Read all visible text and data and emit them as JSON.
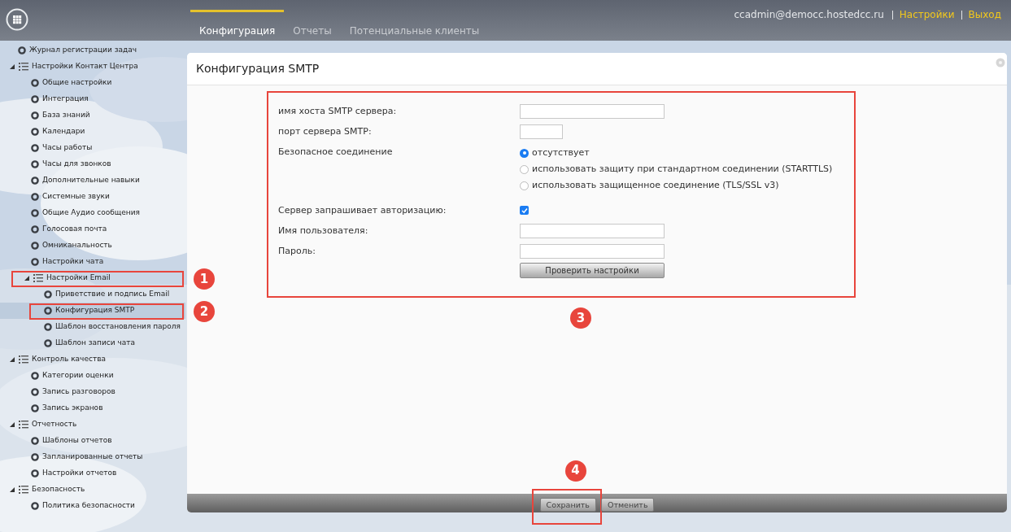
{
  "header": {
    "tabs": [
      {
        "label": "Конфигурация",
        "selected": true
      },
      {
        "label": "Отчеты",
        "selected": false
      },
      {
        "label": "Потенциальные клиенты",
        "selected": false
      }
    ],
    "user": "ccadmin@democc.hostedcc.ru",
    "links": [
      "Настройки",
      "Выход"
    ]
  },
  "sidebar": {
    "items": [
      {
        "label": "Журнал регистрации задач",
        "kind": "leaf",
        "selected": false
      },
      {
        "label": "Настройки Контакт Центра",
        "kind": "group",
        "expanded": true,
        "children": [
          {
            "label": "Общие настройки",
            "kind": "leaf",
            "selected": false
          },
          {
            "label": "Интеграция",
            "kind": "leaf",
            "selected": false
          },
          {
            "label": "База знаний",
            "kind": "leaf",
            "selected": false
          },
          {
            "label": "Календари",
            "kind": "leaf",
            "selected": false
          },
          {
            "label": "Часы работы",
            "kind": "leaf",
            "selected": false
          },
          {
            "label": "Часы для звонков",
            "kind": "leaf",
            "selected": false
          },
          {
            "label": "Дополнительные навыки",
            "kind": "leaf",
            "selected": false
          },
          {
            "label": "Системные звуки",
            "kind": "leaf",
            "selected": false
          },
          {
            "label": "Общие Аудио сообщения",
            "kind": "leaf",
            "selected": false
          },
          {
            "label": "Голосовая почта",
            "kind": "leaf",
            "selected": false
          },
          {
            "label": "Омниканальность",
            "kind": "leaf",
            "selected": false
          },
          {
            "label": "Настройки чата",
            "kind": "leaf",
            "selected": false
          },
          {
            "label": "Настройки Email",
            "kind": "group",
            "expanded": true,
            "callout": "1",
            "children": [
              {
                "label": "Приветствие и подпись Email",
                "kind": "leaf",
                "selected": false
              },
              {
                "label": "Конфигурация SMTP",
                "kind": "leaf",
                "selected": true,
                "callout": "2"
              },
              {
                "label": "Шаблон восстановления пароля",
                "kind": "leaf",
                "selected": false
              },
              {
                "label": "Шаблон записи чата",
                "kind": "leaf",
                "selected": false
              }
            ]
          }
        ]
      },
      {
        "label": "Контроль качества",
        "kind": "group",
        "expanded": true,
        "children": [
          {
            "label": "Категории оценки",
            "kind": "leaf",
            "selected": false
          },
          {
            "label": "Запись разговоров",
            "kind": "leaf",
            "selected": false
          },
          {
            "label": "Запись экранов",
            "kind": "leaf",
            "selected": false
          }
        ]
      },
      {
        "label": "Отчетность",
        "kind": "group",
        "expanded": true,
        "children": [
          {
            "label": "Шаблоны отчетов",
            "kind": "leaf",
            "selected": false
          },
          {
            "label": "Запланированные отчеты",
            "kind": "leaf",
            "selected": false
          },
          {
            "label": "Настройки отчетов",
            "kind": "leaf",
            "selected": false
          }
        ]
      },
      {
        "label": "Безопасность",
        "kind": "group",
        "expanded": true,
        "children": [
          {
            "label": "Политика безопасности",
            "kind": "leaf",
            "selected": false
          }
        ]
      }
    ]
  },
  "panel": {
    "title": "Конфигурация SMTP",
    "form": {
      "callout": "3",
      "rows": [
        {
          "kind": "text",
          "label": "имя хоста SMTP сервера:"
        },
        {
          "kind": "short_text",
          "label": "порт сервера SMTP:"
        },
        {
          "kind": "radio",
          "label": "Безопасное соединение",
          "options": [
            {
              "label": "отсутствует",
              "selected": true
            },
            {
              "label": "использовать защиту при стандартном соединении (STARTTLS)",
              "selected": false
            },
            {
              "label": "использовать защищенное соединение (TLS/SSL v3)",
              "selected": false
            }
          ]
        },
        {
          "kind": "checkbox",
          "label": "Сервер запрашивает авторизацию:",
          "checked": true
        },
        {
          "kind": "text",
          "label": "Имя пользователя:"
        },
        {
          "kind": "text",
          "label": "Пароль:"
        },
        {
          "kind": "button",
          "label": "Проверить настройки"
        }
      ]
    },
    "footer": {
      "buttons": [
        {
          "label": "Сохранить",
          "callout": "4"
        },
        {
          "label": "Отменить"
        }
      ]
    }
  }
}
